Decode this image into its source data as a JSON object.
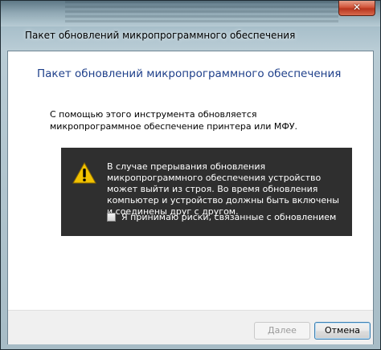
{
  "window": {
    "title": "Пакет обновлений микропрограммного обеспечения",
    "close_glyph": "✕"
  },
  "content": {
    "heading": "Пакет обновлений микропрограммного обеспечения",
    "description": "С помощью этого инструмента обновляется микропрограммное обеспечение принтера или МФУ."
  },
  "warning": {
    "icon": "warning-icon",
    "text": "В случае прерывания обновления микропрограммного обеспечения устройство может выйти из строя. Во время обновления компьютер и устройство должны быть включены и соединены друг с другом.",
    "checkbox_label": "Я принимаю риски, связанные с обновлением",
    "checkbox_checked": false
  },
  "footer": {
    "next_label": "Далее",
    "cancel_label": "Отмена",
    "next_enabled": false
  },
  "colors": {
    "heading": "#1e3f8a",
    "warning_bg": "#2f2f2f",
    "warning_icon": "#f2c200"
  }
}
